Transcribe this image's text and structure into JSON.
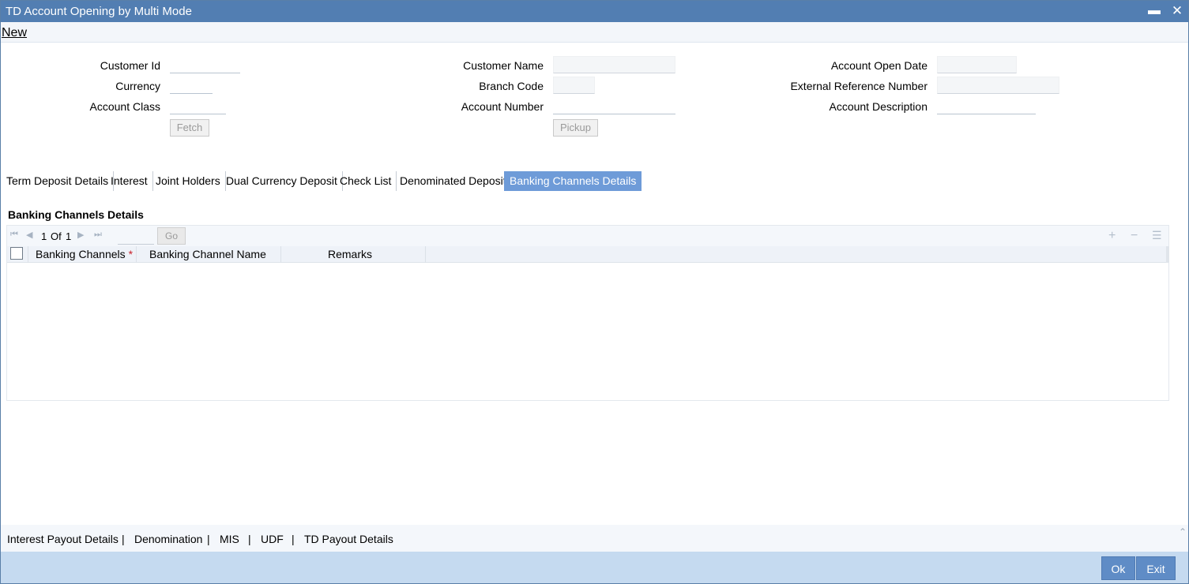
{
  "window": {
    "title": "TD Account Opening by Multi Mode"
  },
  "menu": {
    "new_label": "New"
  },
  "form": {
    "customer_id_label": "Customer Id",
    "currency_label": "Currency",
    "account_class_label": "Account Class",
    "customer_name_label": "Customer Name",
    "branch_code_label": "Branch Code",
    "account_number_label": "Account Number",
    "account_open_date_label": "Account Open Date",
    "external_reference_label": "External Reference Number",
    "account_description_label": "Account Description",
    "fetch_label": "Fetch",
    "pickup_label": "Pickup"
  },
  "tabs": [
    {
      "label": "Term Deposit Details"
    },
    {
      "label": "Interest"
    },
    {
      "label": "Joint Holders"
    },
    {
      "label": "Dual Currency Deposit"
    },
    {
      "label": "Check List"
    },
    {
      "label": "Denominated Deposit"
    },
    {
      "label": "Banking Channels Details",
      "active": true
    }
  ],
  "section": {
    "title": "Banking Channels Details",
    "pager": {
      "current": "1",
      "of_label": "Of",
      "total": "1",
      "go_label": "Go"
    },
    "columns": [
      {
        "label": "Banking Channels",
        "required_mark": "*"
      },
      {
        "label": "Banking Channel Name"
      },
      {
        "label": "Remarks"
      }
    ]
  },
  "bottom_links": [
    {
      "label": "Interest Payout Details"
    },
    {
      "label": "Denomination"
    },
    {
      "label": "MIS"
    },
    {
      "label": "UDF"
    },
    {
      "label": "TD Payout Details"
    }
  ],
  "bottom_separator": "|",
  "actions": {
    "ok_label": "Ok",
    "exit_label": "Exit"
  },
  "icons": {
    "minimize": "minimize-icon",
    "close": "close-icon",
    "first_page": "first-page-icon",
    "prev_page": "prev-page-icon",
    "next_page": "next-page-icon",
    "last_page": "last-page-icon",
    "add_row": "add-row-icon",
    "delete_row": "delete-row-icon",
    "single_view": "single-view-icon"
  },
  "colors": {
    "titlebar": "#527eb2",
    "active_tab": "#6e9bd8",
    "footer": "#c5daf0",
    "button": "#5f8cc6"
  }
}
